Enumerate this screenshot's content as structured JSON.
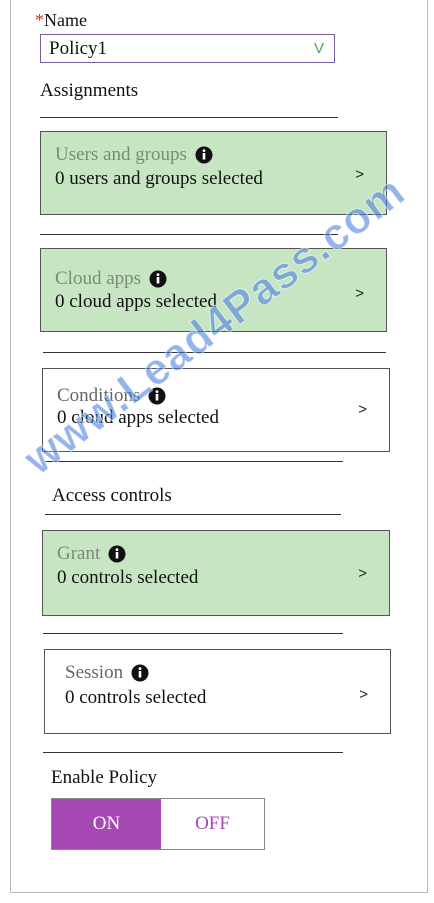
{
  "name_field": {
    "required_marker": "*",
    "label": "Name",
    "value": "Policy1",
    "dropdown_glyph": "V"
  },
  "assignments": {
    "heading": "Assignments",
    "cards": [
      {
        "title": "Users and groups",
        "subtitle": "0 users and groups selected",
        "arrow": ">",
        "icon": "info-icon"
      },
      {
        "title": "Cloud apps",
        "subtitle": "0 cloud apps selected",
        "arrow": ">",
        "icon": "info-icon"
      },
      {
        "title": "Conditions",
        "subtitle": "0 cloud apps selected",
        "arrow": ">",
        "icon": "info-icon"
      }
    ]
  },
  "access_controls": {
    "heading": "Access controls",
    "cards": [
      {
        "title": "Grant",
        "subtitle": "0 controls selected",
        "arrow": ">",
        "icon": "info-icon"
      },
      {
        "title": "Session",
        "subtitle": "0 controls selected",
        "arrow": ">",
        "icon": "info-icon"
      }
    ]
  },
  "enable_policy": {
    "label": "Enable Policy",
    "on_label": "ON",
    "off_label": "OFF",
    "selected": "ON"
  },
  "watermark": "www.Lead4Pass.com",
  "colors": {
    "card_selected_bg": "#c8e5c3",
    "toggle_on_bg": "#a548b3",
    "toggle_off_text": "#a548b3"
  }
}
